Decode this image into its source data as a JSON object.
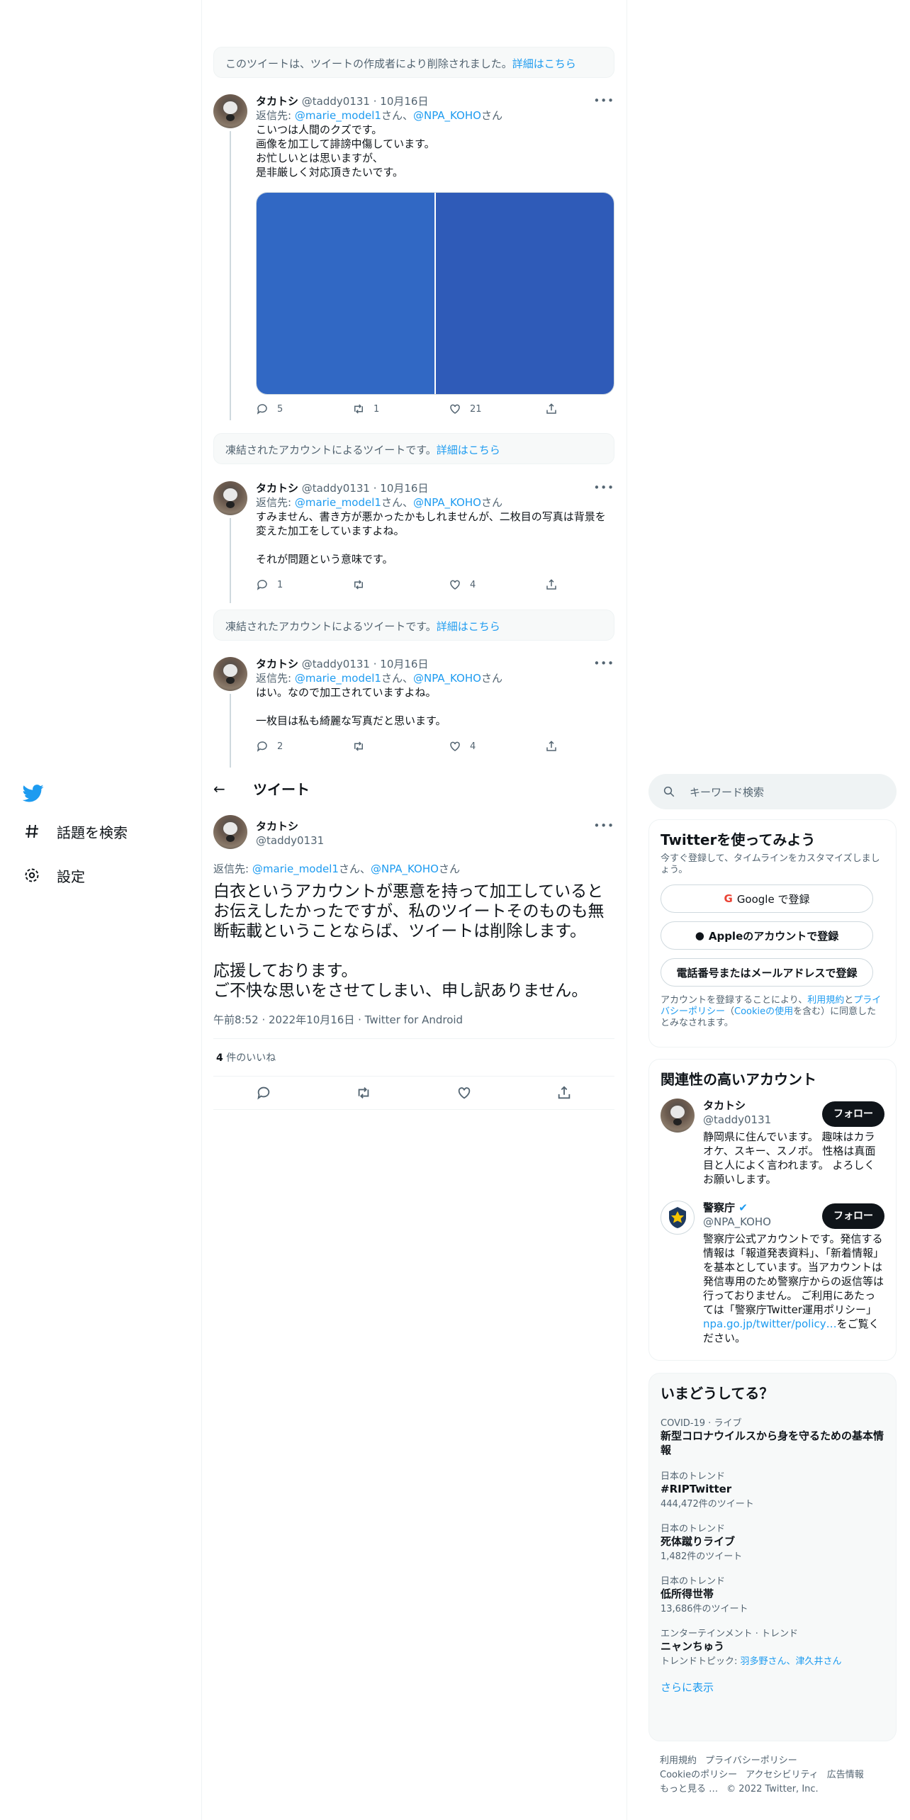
{
  "nav": {
    "items": [
      {
        "label": "話題を検索",
        "icon": "hash-icon"
      },
      {
        "label": "設定",
        "icon": "gear-icon"
      }
    ]
  },
  "thread": {
    "deleted_notice": {
      "text": "このツイートは、ツイートの作成者により削除されました。",
      "link": "詳細はこちら"
    },
    "suspended_notice": {
      "text": "凍結されたアカウントによるツイートです。",
      "link": "詳細はこちら"
    },
    "reply_prefix": "返信先: ",
    "mention1": "@marie_model1",
    "mention_sep": "さん、",
    "mention2": "@NPA_KOHO",
    "mention_suffix": "さん",
    "tweets": [
      {
        "name": "タカトシ",
        "handle": "@taddy0131",
        "date": "· 10月16日",
        "text": "こいつは人間のクズです。\n画像を加工して誹謗中傷しています。\nお忙しいとは思いますが、\n是非厳しく対応頂きたいです。",
        "replies": "5",
        "retweets": "1",
        "likes": "21"
      },
      {
        "name": "タカトシ",
        "handle": "@taddy0131",
        "date": "· 10月16日",
        "text": "すみません、書き方が悪かったかもしれませんが、二枚目の写真は背景を変えた加工をしていますよね。\n\nそれが問題という意味です。",
        "replies": "1",
        "retweets": "",
        "likes": "4"
      },
      {
        "name": "タカトシ",
        "handle": "@taddy0131",
        "date": "· 10月16日",
        "text": "はい。なので加工されていますよね。\n\n一枚目は私も綺麗な写真だと思います。",
        "replies": "2",
        "retweets": "",
        "likes": "4"
      }
    ]
  },
  "header": {
    "back": "←",
    "title": "ツイート"
  },
  "main_tweet": {
    "name": "タカトシ",
    "handle": "@taddy0131",
    "reply_prefix": "返信先: ",
    "mention1": "@marie_model1",
    "mention_sep": "さん、",
    "mention2": "@NPA_KOHO",
    "mention_suffix": "さん",
    "text": "白衣というアカウントが悪意を持って加工しているとお伝えしたかったですが、私のツイートそのものも無断転載ということならば、ツイートは削除します。\n\n応援しております。\nご不快な思いをさせてしまい、申し訳ありません。",
    "meta": "午前8:52 · 2022年10月16日 · Twitter for Android",
    "likes_count": "4",
    "likes_label": " 件のいいね"
  },
  "search": {
    "placeholder": "キーワード検索"
  },
  "signup": {
    "title": "Twitterを使ってみよう",
    "subtitle": "今すぐ登録して、タイムラインをカスタマイズしましょう。",
    "google": "Google で登録",
    "apple": "Appleのアカウントで登録",
    "phone": "電話番号またはメールアドレスで登録",
    "legal_pre": "アカウントを登録することにより、",
    "legal_link1": "利用規約",
    "legal_mid": "と",
    "legal_link2": "プライバシーポリシー",
    "legal_mid2": "（",
    "legal_link3": "Cookieの使用",
    "legal_post": "を含む）に同意したとみなされます。"
  },
  "related": {
    "title": "関連性の高いアカウント",
    "follow": "フォロー",
    "accounts": [
      {
        "name": "タカトシ",
        "handle": "@taddy0131",
        "bio": "静岡県に住んでいます。 趣味はカラオケ、スキー、スノボ。 性格は真面目と人によく言われます。 よろしくお願いします。"
      },
      {
        "name": "警察庁",
        "handle": "@NPA_KOHO",
        "bio": "警察庁公式アカウントです。発信する情報は「報道発表資料」、「新着情報」を基本としています。当アカウントは発信専用のため警察庁からの返信等は行っておりません。 ご利用にあたっては「警察庁Twitter運用ポリシー」",
        "bio_link": "npa.go.jp/twitter/policy…",
        "bio_end": "をご覧ください。"
      }
    ]
  },
  "trends": {
    "title": "いまどうしてる？",
    "items": [
      {
        "context": "COVID-19 · ライブ",
        "title": "新型コロナウイルスから身を守るための基本情報",
        "count": ""
      },
      {
        "context": "日本のトレンド",
        "title": "#RIPTwitter",
        "count": "444,472件のツイート"
      },
      {
        "context": "日本のトレンド",
        "title": "死体蹴りライブ",
        "count": "1,482件のツイート"
      },
      {
        "context": "日本のトレンド",
        "title": "低所得世帯",
        "count": "13,686件のツイート"
      },
      {
        "context": "エンターテインメント · トレンド",
        "title": "ニャンちゅう",
        "count": "トレンドトピック: ",
        "links": "羽多野さん、津久井さん"
      }
    ],
    "show_more": "さらに表示"
  },
  "footer": {
    "links": [
      "利用規約",
      "プライバシーポリシー",
      "Cookieのポリシー",
      "アクセシビリティ",
      "広告情報",
      "もっと見る …"
    ],
    "copyright": "© 2022 Twitter, Inc."
  },
  "colors": {
    "accent": "#1d9bf0",
    "media_left": "#3168c4",
    "media_right": "#2f5bb8"
  }
}
